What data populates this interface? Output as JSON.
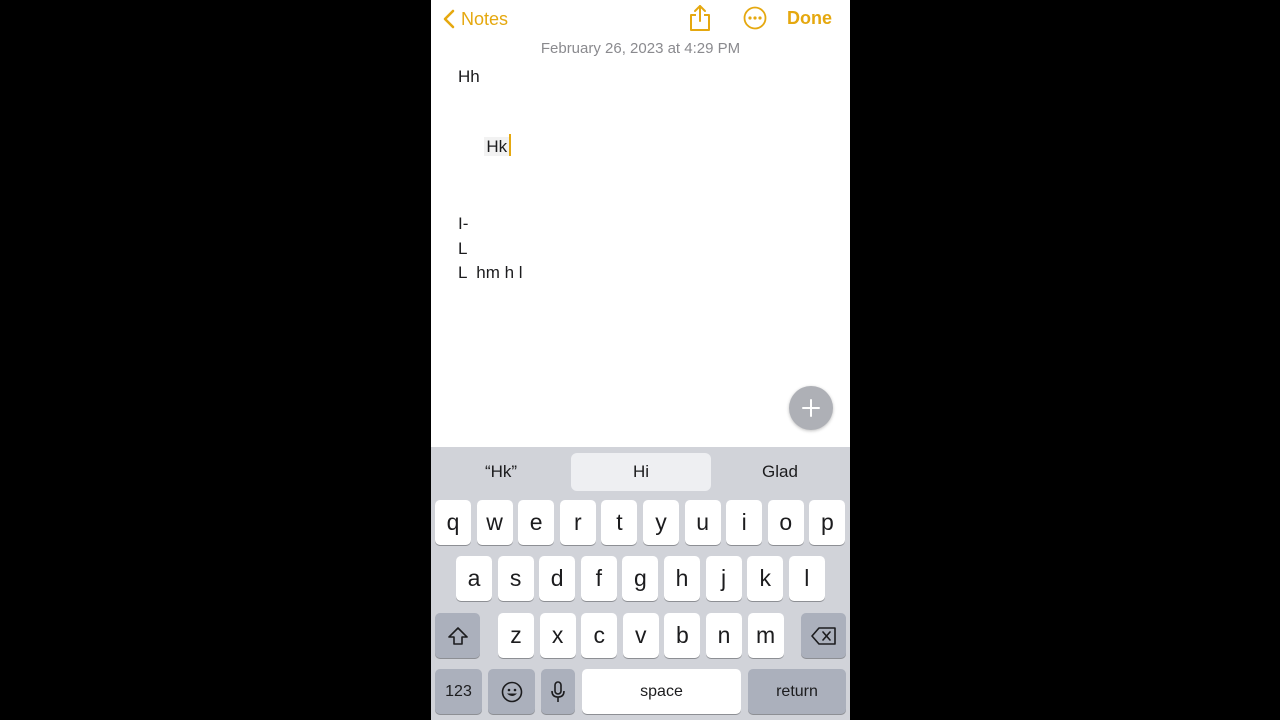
{
  "nav": {
    "back_label": "Notes",
    "done_label": "Done",
    "share_icon": "share-icon",
    "more_icon": "ellipsis-circle-icon"
  },
  "note": {
    "date": "February 26, 2023 at 4:29 PM",
    "lines": [
      "Hh",
      "Hk",
      "I-",
      "L",
      "L  hm h l"
    ]
  },
  "fab_icon": "plus-icon",
  "keyboard": {
    "suggestions": [
      "“Hk”",
      "Hi",
      "Glad"
    ],
    "row1": [
      "q",
      "w",
      "e",
      "r",
      "t",
      "y",
      "u",
      "i",
      "o",
      "p"
    ],
    "row2": [
      "a",
      "s",
      "d",
      "f",
      "g",
      "h",
      "j",
      "k",
      "l"
    ],
    "row3": [
      "z",
      "x",
      "c",
      "v",
      "b",
      "n",
      "m"
    ],
    "numbers_label": "123",
    "space_label": "space",
    "return_label": "return"
  },
  "colors": {
    "accent": "#e5a80f",
    "keyboard_bg": "#d1d3d9",
    "key_dark": "#abb0bc"
  }
}
